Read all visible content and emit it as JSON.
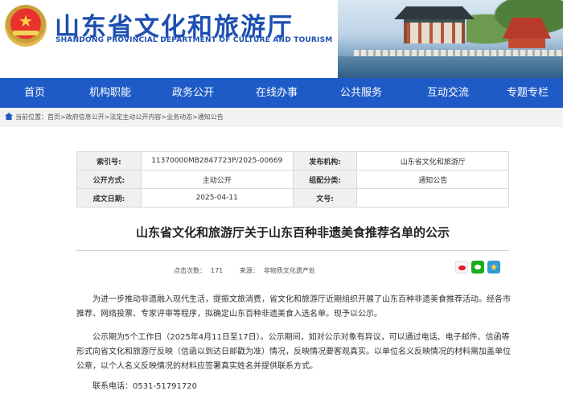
{
  "header": {
    "title": "山东省文化和旅游厅",
    "subtitle": "SHANDONG PROVINCIAL DEPARTMENT OF CULTURE AND TOURISM"
  },
  "nav": {
    "items": [
      {
        "label": "首页"
      },
      {
        "label": "机构职能"
      },
      {
        "label": "政务公开"
      },
      {
        "label": "在线办事"
      },
      {
        "label": "公共服务"
      },
      {
        "label": "互动交流"
      },
      {
        "label": "专题专栏"
      }
    ]
  },
  "breadcrumb": {
    "prefix": "当前位置：",
    "path": "首页>政府信息公开>法定主动公开内容>业务动态>通知公告"
  },
  "meta": {
    "index_label": "索引号:",
    "index_value": "11370000MB2847723P/2025-00669",
    "publisher_label": "发布机构:",
    "publisher_value": "山东省文化和旅游厅",
    "method_label": "公开方式:",
    "method_value": "主动公开",
    "category_label": "组配分类:",
    "category_value": "通知公告",
    "date_label": "成文日期:",
    "date_value": "2025-04-11",
    "docno_label": "文号:",
    "docno_value": ""
  },
  "article": {
    "title": "山东省文化和旅游厅关于山东百种非遗美食推荐名单的公示",
    "clicks_label": "点击次数：",
    "clicks_value": "171",
    "source_label": "来源：",
    "source_value": "非物质文化遗产处",
    "paragraphs": [
      "为进一步推动非遗融入现代生活，提振文旅消费，省文化和旅游厅近期组织开展了山东百种非遗美食推荐活动。经各市推荐、网络投票、专家评审等程序，拟确定山东百种非遗美食入选名单。现予以公示。",
      "公示期为5个工作日（2025年4月11日至17日）。公示期间，如对公示对象有异议，可以通过电话、电子邮件、信函等形式向省文化和旅游厅反映（信函以到达日邮戳为准）情况，反映情况要客观真实。以单位名义反映情况的材料需加盖单位公章，以个人名义反映情况的材料应签署真实姓名并提供联系方式。",
      "联系电话：0531-51791720"
    ]
  },
  "colors": {
    "brand_blue": "#1f5bc6",
    "title_blue": "#1d4fb1"
  },
  "icons": [
    "national-emblem-icon",
    "home-icon",
    "weibo-share-icon",
    "wechat-share-icon",
    "qzone-share-icon"
  ]
}
